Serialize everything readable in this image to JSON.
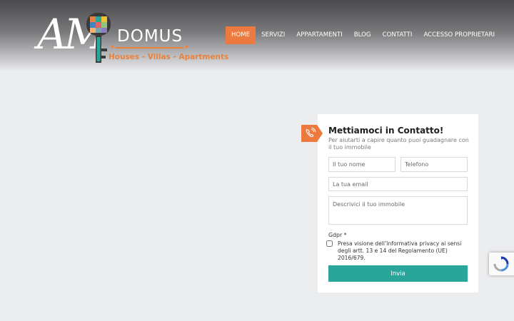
{
  "brand": {
    "mark": "AM",
    "name": "DOMUS",
    "tagline": "Houses - Villas - Apartments",
    "colors": {
      "accent": "#ec7a3e",
      "teal": "#2aa59a"
    }
  },
  "nav": {
    "items": [
      {
        "label": "HOME",
        "active": true
      },
      {
        "label": "SERVIZI"
      },
      {
        "label": "APPARTAMENTI"
      },
      {
        "label": "BLOG"
      },
      {
        "label": "CONTATTI"
      },
      {
        "label": "ACCESSO PROPRIETARI"
      }
    ]
  },
  "contact_form": {
    "icon": "phone-icon",
    "title": "Mettiamoci in Contatto!",
    "subtitle": "Per aiutarti a capire quanto puoi guadagnare con il tuo immobile",
    "name_placeholder": "Il tuo nome",
    "phone_placeholder": "Telefono",
    "email_placeholder": "La tua email",
    "description_placeholder": "Descrivici il tuo immobile",
    "gdpr_label": "Gdpr *",
    "gdpr_text": "Presa visione dell’informativa privacy ai sensi degli artt. 13 e 14 del Regolamento (UE) 2016/679.",
    "gdpr_checked": false,
    "submit_label": "Invia"
  },
  "recaptcha": {
    "icon": "recaptcha-icon"
  }
}
